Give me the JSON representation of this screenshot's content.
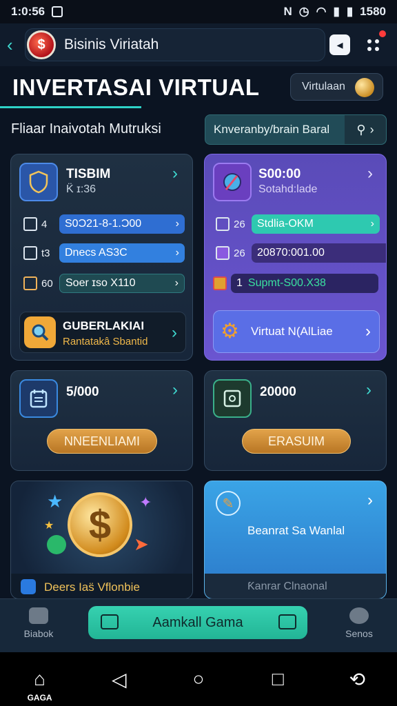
{
  "status_bar": {
    "time": "1:0:56",
    "battery": "1580"
  },
  "top_bar": {
    "app_title": "Bisinis Viriatah"
  },
  "hero": {
    "title": "INVERTASAI VIRTUAL",
    "mode_label": "Virtulaan"
  },
  "filter": {
    "label": "Fliaar Inaivotah Mutruksi",
    "search_value": "Knveranby/brain Baral"
  },
  "card1": {
    "title": "TISBIM",
    "subtitle": "K̈ ɪ:36",
    "rows": [
      {
        "num": "4",
        "value": "S0Ɔ21-8-1.Ɔ00"
      },
      {
        "num": "t3",
        "value": "Dnecs AS3C"
      },
      {
        "num": "60",
        "value": "Soer ɪso X110"
      }
    ],
    "sub_title": "GUBERLAKIAI",
    "sub_text": "Rantatakâ Sbantid"
  },
  "card2": {
    "title": "S00:00",
    "subtitle": "Sotahd:lade",
    "rows": [
      {
        "num": "26",
        "value": "Stdlia-OKM"
      },
      {
        "num": "26",
        "value": "20870:001.00"
      },
      {
        "num": "1",
        "value": "Supmt-S00.X38"
      }
    ],
    "sub_title": "Virtuat N(AlLiae"
  },
  "card3": {
    "value": "5/000",
    "button": "NNEENLIAMI"
  },
  "card4": {
    "value": "20000",
    "button": "ERASUIM"
  },
  "card5": {
    "caption": "Deers Ias̈  Vflonbie"
  },
  "card6": {
    "title": "Beanrat Sa Wanlal",
    "caption": "Ƙanrar Clnaonal"
  },
  "bottom_nav": {
    "left_label": "Biabok",
    "cta_label": "Aamkall Gama",
    "right_label": "Senos"
  },
  "sys_nav": {
    "home_label": "GAGA"
  }
}
